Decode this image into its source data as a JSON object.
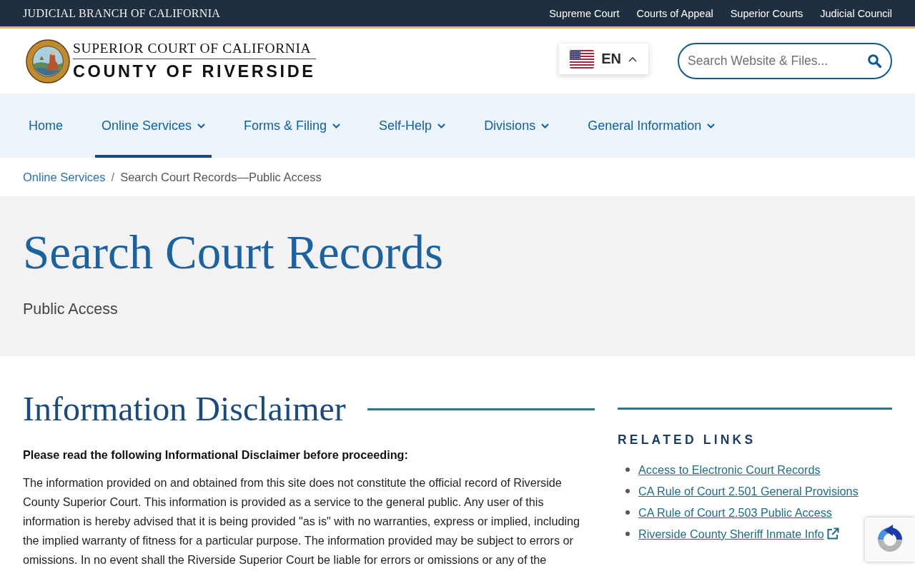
{
  "top_bar": {
    "title": "JUDICIAL BRANCH OF CALIFORNIA",
    "links": [
      "Supreme Court",
      "Courts of Appeal",
      "Superior Courts",
      "Judicial Council"
    ]
  },
  "header": {
    "logo": {
      "line_1": "SUPERIOR COURT OF CALIFORNIA",
      "line_2": "COUNTY OF RIVERSIDE"
    },
    "language_selector": {
      "label": "EN"
    },
    "search": {
      "placeholder": "Search Website & Files..."
    }
  },
  "nav": {
    "items": [
      {
        "label": "Home",
        "dropdown": false,
        "selected": false
      },
      {
        "label": "Online Services",
        "dropdown": true,
        "selected": true
      },
      {
        "label": "Forms & Filing",
        "dropdown": true,
        "selected": false
      },
      {
        "label": "Self-Help",
        "dropdown": true,
        "selected": false
      },
      {
        "label": "Divisions",
        "dropdown": true,
        "selected": false
      },
      {
        "label": "General Information",
        "dropdown": true,
        "selected": false
      }
    ]
  },
  "breadcrumb": {
    "separator": "/",
    "items": [
      {
        "label": "Online Services",
        "kind": "link"
      },
      {
        "label": "Search Court Records—Public Access",
        "kind": "current"
      }
    ]
  },
  "hero": {
    "title": "Search Court Records",
    "subtitle": "Public Access"
  },
  "main": {
    "heading": "Information Disclaimer",
    "intro": "Please read the following Informational Disclaimer before proceeding:",
    "body": "The information provided on and obtained from this site does not constitute the official record of Riverside County Superior Court. This information is provided as a service to the general public. Any user of this information is hereby advised that it is being provided \"as is\" with no warranties, express or implied, including the implied warranty of fitness for a particular purpose. The information provided may be subject to errors or omissions. In no event shall the Riverside Superior Court be liable for errors or omissions or any of the"
  },
  "sidebar": {
    "heading": "RELATED LINKS",
    "links": [
      {
        "label": "Access to Electronic Court Records",
        "external": false
      },
      {
        "label": "CA Rule of Court 2.501 General Provisions",
        "external": false
      },
      {
        "label": "CA Rule of Court 2.503 Public Access",
        "external": false
      },
      {
        "label": "Riverside County Sheriff Inmate Info",
        "external": true
      }
    ]
  }
}
